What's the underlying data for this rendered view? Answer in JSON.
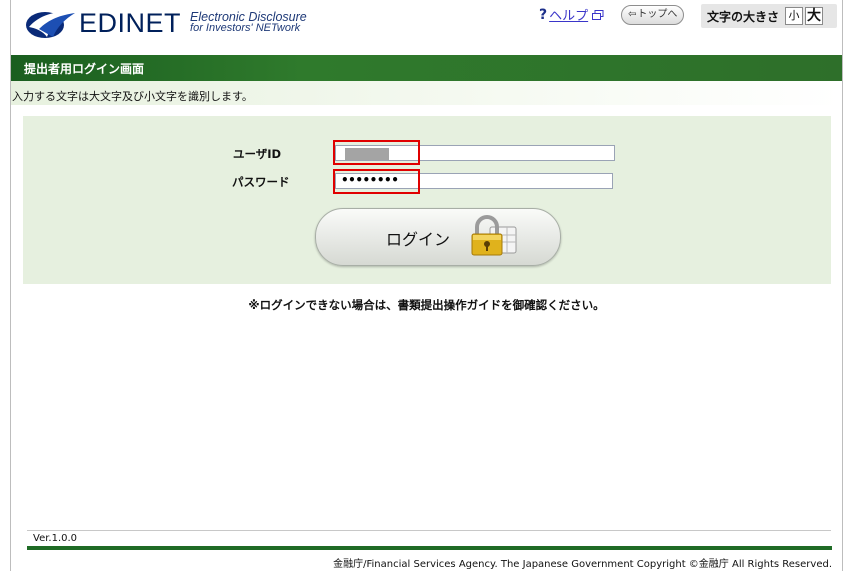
{
  "header": {
    "logo_name": "EDINET",
    "logo_sub_line1": "Electronic Disclosure",
    "logo_sub_line2": "for Investors' NETwork",
    "help_mark": "?",
    "help_label": "ヘルプ",
    "top_button_arrow": "⇦",
    "top_button_label": "トップへ",
    "font_size_label": "文字の大きさ",
    "font_small": "小",
    "font_large": "大"
  },
  "title": "提出者用ログイン画面",
  "notice": "入力する文字は大文字及び小文字を識別します。",
  "form": {
    "user_id_label": "ユーザID",
    "password_label": "パスワード",
    "password_value": "••••••••",
    "login_button": "ログイン"
  },
  "guide": "※ログインできない場合は、書類提出操作ガイドを御確認ください。",
  "version": "Ver.1.0.0",
  "copyright": "金融庁/Financial Services Agency. The Japanese Government Copyright ©金融庁 All Rights Reserved.",
  "colors": {
    "brand_navy": "#00205b",
    "title_green": "#1f6b25",
    "panel_green": "#e6f0df",
    "highlight_red": "#e00000"
  }
}
